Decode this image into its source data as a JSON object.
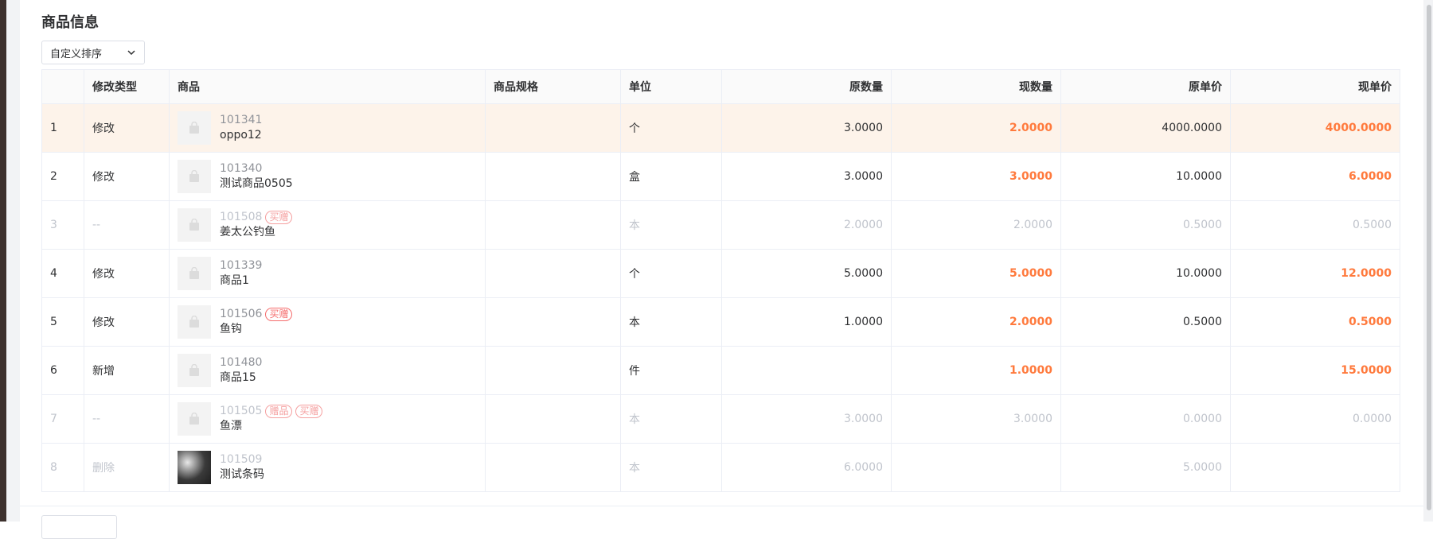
{
  "section": {
    "title": "商品信息"
  },
  "sort": {
    "selected": "自定义排序"
  },
  "table": {
    "headers": {
      "index": "",
      "type": "修改类型",
      "product": "商品",
      "spec": "商品规格",
      "unit": "单位",
      "orig_qty": "原数量",
      "curr_qty": "现数量",
      "orig_price": "原单价",
      "curr_price": "现单价"
    },
    "rows": [
      {
        "index": "1",
        "type": "修改",
        "code": "101341",
        "tags": [],
        "name": "oppo12",
        "spec": "",
        "unit": "个",
        "orig_qty": "3.0000",
        "curr_qty": "2.0000",
        "orig_price": "4000.0000",
        "curr_price": "4000.0000"
      },
      {
        "index": "2",
        "type": "修改",
        "code": "101340",
        "tags": [],
        "name": "测试商品0505",
        "spec": "",
        "unit": "盒",
        "orig_qty": "3.0000",
        "curr_qty": "3.0000",
        "orig_price": "10.0000",
        "curr_price": "6.0000"
      },
      {
        "index": "3",
        "type": "--",
        "code": "101508",
        "tags": [
          "买赠"
        ],
        "name": "姜太公钓鱼",
        "spec": "",
        "unit": "本",
        "orig_qty": "2.0000",
        "curr_qty": "2.0000",
        "orig_price": "0.5000",
        "curr_price": "0.5000"
      },
      {
        "index": "4",
        "type": "修改",
        "code": "101339",
        "tags": [],
        "name": "商品1",
        "spec": "",
        "unit": "个",
        "orig_qty": "5.0000",
        "curr_qty": "5.0000",
        "orig_price": "10.0000",
        "curr_price": "12.0000"
      },
      {
        "index": "5",
        "type": "修改",
        "code": "101506",
        "tags": [
          "买赠"
        ],
        "name": "鱼钩",
        "spec": "",
        "unit": "本",
        "orig_qty": "1.0000",
        "curr_qty": "2.0000",
        "orig_price": "0.5000",
        "curr_price": "0.5000"
      },
      {
        "index": "6",
        "type": "新增",
        "code": "101480",
        "tags": [],
        "name": "商品15",
        "spec": "",
        "unit": "件",
        "orig_qty": "",
        "curr_qty": "1.0000",
        "orig_price": "",
        "curr_price": "15.0000"
      },
      {
        "index": "7",
        "type": "--",
        "code": "101505",
        "tags": [
          "赠品",
          "买赠"
        ],
        "name": "鱼漂",
        "spec": "",
        "unit": "本",
        "orig_qty": "3.0000",
        "curr_qty": "3.0000",
        "orig_price": "0.0000",
        "curr_price": "0.0000"
      },
      {
        "index": "8",
        "type": "删除",
        "code": "101509",
        "tags": [],
        "name": "测试条码",
        "spec": "",
        "unit": "本",
        "orig_qty": "6.0000",
        "curr_qty": "",
        "orig_price": "5.0000",
        "curr_price": ""
      }
    ]
  },
  "colors": {
    "accent": "#ff7a3d",
    "tag": "#f56c6c",
    "highlight_row": "#fdf3ea",
    "muted": "#c0c4cc"
  },
  "icons": {
    "select": "chevron-down-icon",
    "thumb_placeholder": "bag-icon"
  }
}
